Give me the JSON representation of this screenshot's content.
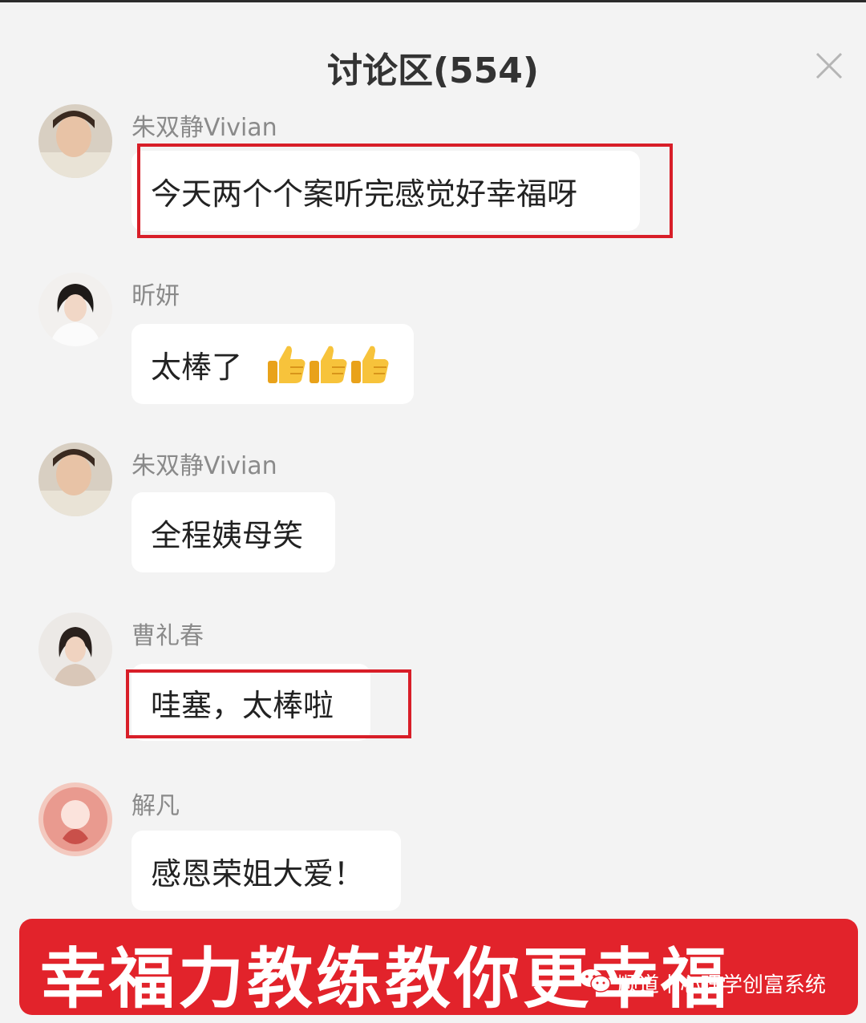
{
  "header": {
    "title": "讨论区(554)",
    "close_icon": "close-icon"
  },
  "comments": [
    {
      "username": "朱双静Vivian",
      "text": "今天两个个案听完感觉好幸福呀",
      "highlighted": true
    },
    {
      "username": "昕妍",
      "text": "太棒了",
      "emoji": [
        "thumbs-up-icon",
        "thumbs-up-icon",
        "thumbs-up-icon"
      ],
      "highlighted": false
    },
    {
      "username": "朱双静Vivian",
      "text": "全程姨母笑",
      "highlighted": false
    },
    {
      "username": "曹礼春",
      "text": "哇塞，太棒啦",
      "highlighted": true
    },
    {
      "username": "解凡",
      "text": "感恩荣姐大爱！",
      "highlighted": false
    }
  ],
  "banner": {
    "text": "幸福力教练教你更幸福"
  },
  "watermark": {
    "icon": "wechat-icon",
    "text": "顺道丨心理学创富系统"
  },
  "colors": {
    "highlight_border": "#d81e28",
    "banner_bg": "#e2232b",
    "page_bg": "#f3f3f3"
  }
}
